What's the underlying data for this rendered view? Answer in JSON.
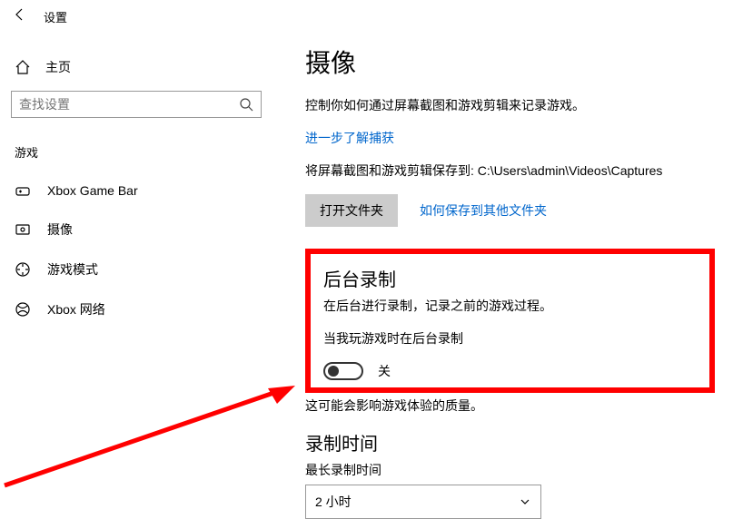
{
  "topbar": {
    "title": "设置"
  },
  "sidebar": {
    "home": "主页",
    "search_placeholder": "查找设置",
    "category": "游戏",
    "items": [
      {
        "label": "Xbox Game Bar"
      },
      {
        "label": "摄像"
      },
      {
        "label": "游戏模式"
      },
      {
        "label": "Xbox 网络"
      }
    ]
  },
  "main": {
    "h1": "摄像",
    "desc": "控制你如何通过屏幕截图和游戏剪辑来记录游戏。",
    "learn_more": "进一步了解捕获",
    "save_path_text": "将屏幕截图和游戏剪辑保存到: C:\\Users\\admin\\Videos\\Captures",
    "open_folder": "打开文件夹",
    "save_other": "如何保存到其他文件夹",
    "bg": {
      "h2": "后台录制",
      "desc": "在后台进行录制，记录之前的游戏过程。",
      "toggle_label": "当我玩游戏时在后台录制",
      "toggle_state": "关",
      "warn": "这可能会影响游戏体验的质量。"
    },
    "rec_time": {
      "h2": "录制时间",
      "max_label": "最长录制时间",
      "value": "2 小时"
    }
  }
}
